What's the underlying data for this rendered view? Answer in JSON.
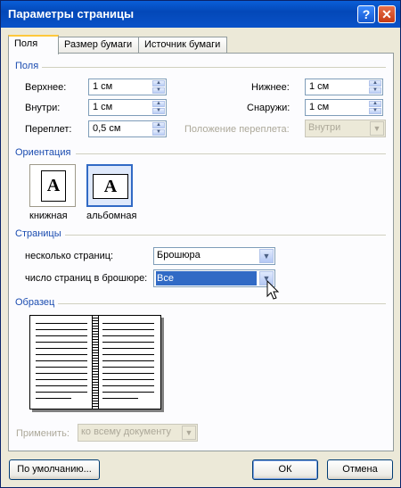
{
  "window": {
    "title": "Параметры страницы",
    "help": "?",
    "close": "✕"
  },
  "tabs": [
    "Поля",
    "Размер бумаги",
    "Источник бумаги"
  ],
  "fields_section": {
    "title": "Поля",
    "top": {
      "label": "Верхнее:",
      "value": "1 см"
    },
    "bottom": {
      "label": "Нижнее:",
      "value": "1 см"
    },
    "inside": {
      "label": "Внутри:",
      "value": "1 см"
    },
    "outside": {
      "label": "Снаружи:",
      "value": "1 см"
    },
    "gutter": {
      "label": "Переплет:",
      "value": "0,5 см"
    },
    "gutter_pos": {
      "label": "Положение переплета:",
      "value": "Внутри"
    }
  },
  "orientation": {
    "title": "Ориентация",
    "portrait": "книжная",
    "landscape": "альбомная",
    "glyph": "A"
  },
  "pages": {
    "title": "Страницы",
    "multiple_label": "несколько страниц:",
    "multiple_value": "Брошюра",
    "booklet_label": "число страниц в брошюре:",
    "booklet_value": "Все"
  },
  "preview": {
    "title": "Образец"
  },
  "apply": {
    "label": "Применить:",
    "value": "ко всему документу"
  },
  "buttons": {
    "default": "По умолчанию...",
    "ok": "ОК",
    "cancel": "Отмена"
  }
}
